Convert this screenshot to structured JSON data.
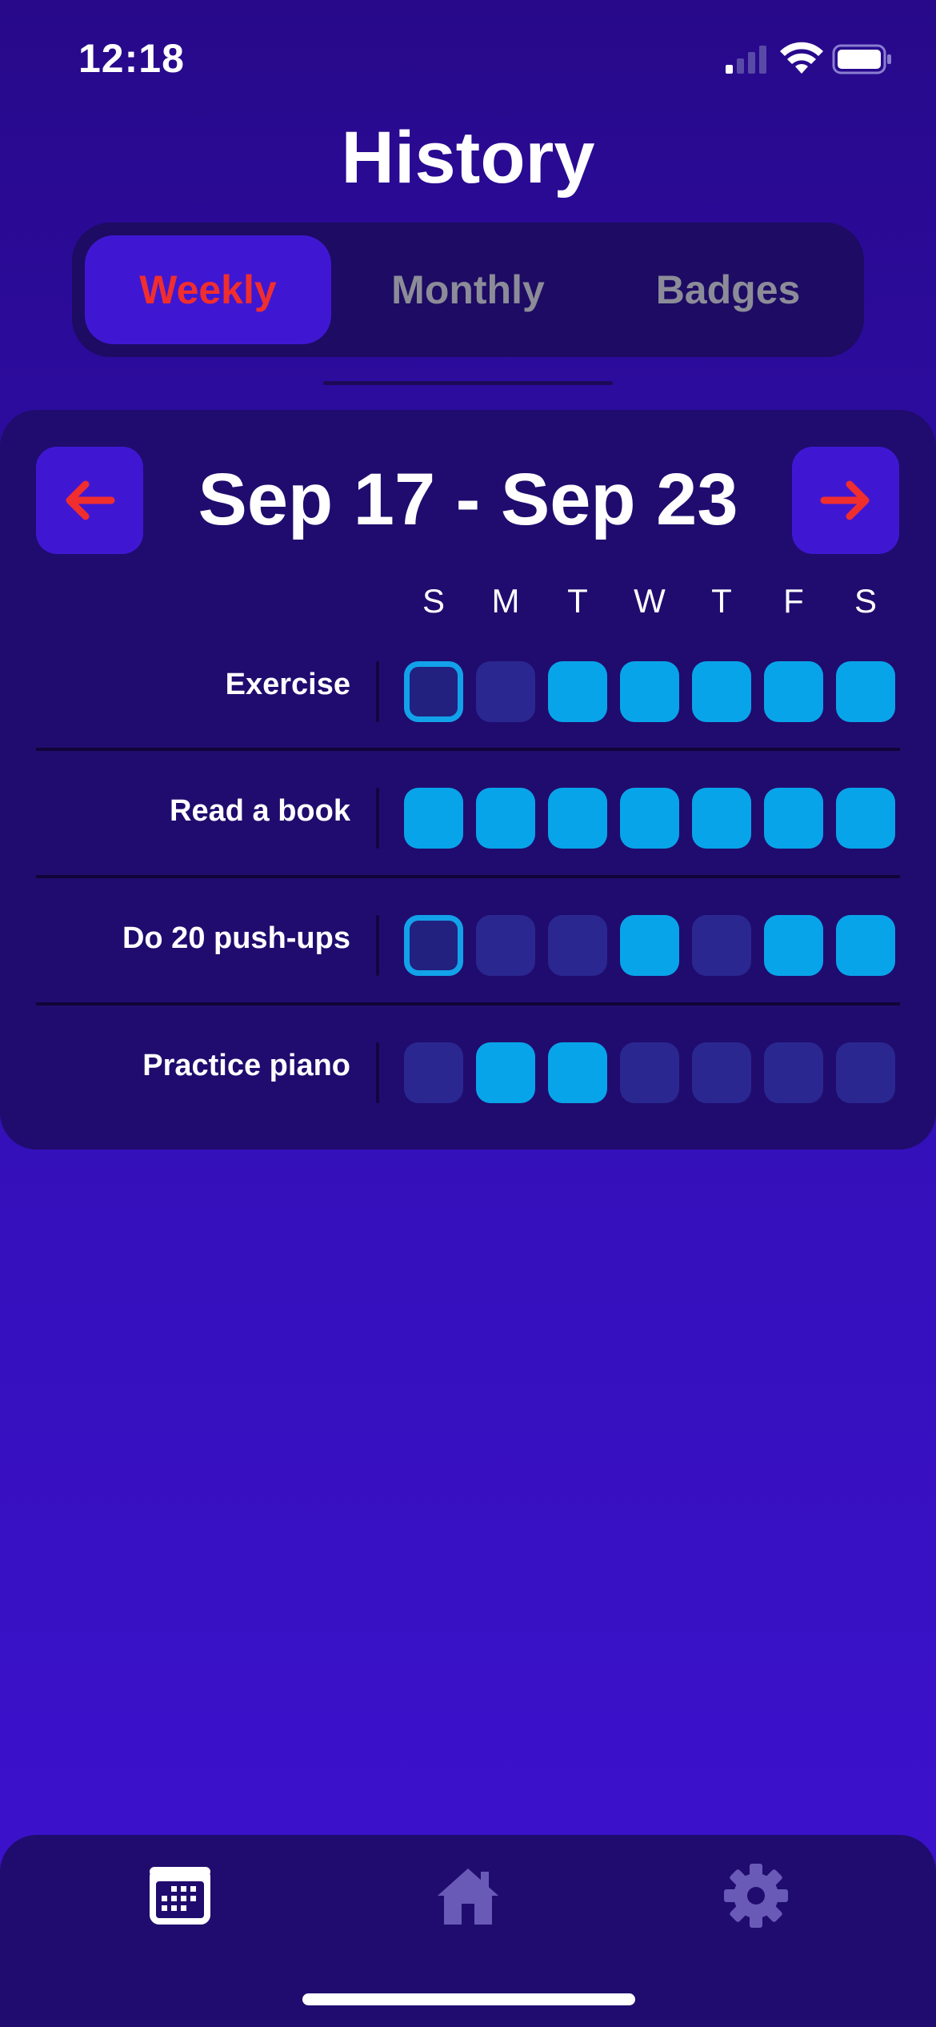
{
  "status_bar": {
    "time": "12:18",
    "icons": [
      "cellular-signal-icon",
      "wifi-icon",
      "battery-icon"
    ]
  },
  "page": {
    "title": "History"
  },
  "segmented": {
    "tabs": [
      {
        "label": "Weekly",
        "active": true
      },
      {
        "label": "Monthly",
        "active": false
      },
      {
        "label": "Badges",
        "active": false
      }
    ]
  },
  "week": {
    "range": "Sep 17 - Sep 23",
    "prev_icon": "arrow-left-icon",
    "next_icon": "arrow-right-icon",
    "days": [
      "S",
      "M",
      "T",
      "W",
      "T",
      "F",
      "S"
    ]
  },
  "habits": [
    {
      "name": "Exercise",
      "days": [
        "today",
        "empty",
        "done",
        "done",
        "done",
        "done",
        "done"
      ]
    },
    {
      "name": "Read a book",
      "days": [
        "done",
        "done",
        "done",
        "done",
        "done",
        "done",
        "done"
      ]
    },
    {
      "name": "Do 20 push-ups",
      "days": [
        "today",
        "empty",
        "empty",
        "done",
        "empty",
        "done",
        "done"
      ]
    },
    {
      "name": "Practice piano",
      "days": [
        "empty",
        "done",
        "done",
        "empty",
        "empty",
        "empty",
        "empty"
      ]
    }
  ],
  "tab_bar": {
    "items": [
      {
        "icon": "calendar-icon",
        "active": true
      },
      {
        "icon": "home-icon",
        "active": false
      },
      {
        "icon": "gear-icon",
        "active": false
      }
    ]
  },
  "colors": {
    "accent_red": "#f02e2e",
    "done_cell": "#08a4ea",
    "empty_cell": "#2a2790",
    "card_bg": "#200c6e",
    "active_segment": "#3f17d3"
  }
}
